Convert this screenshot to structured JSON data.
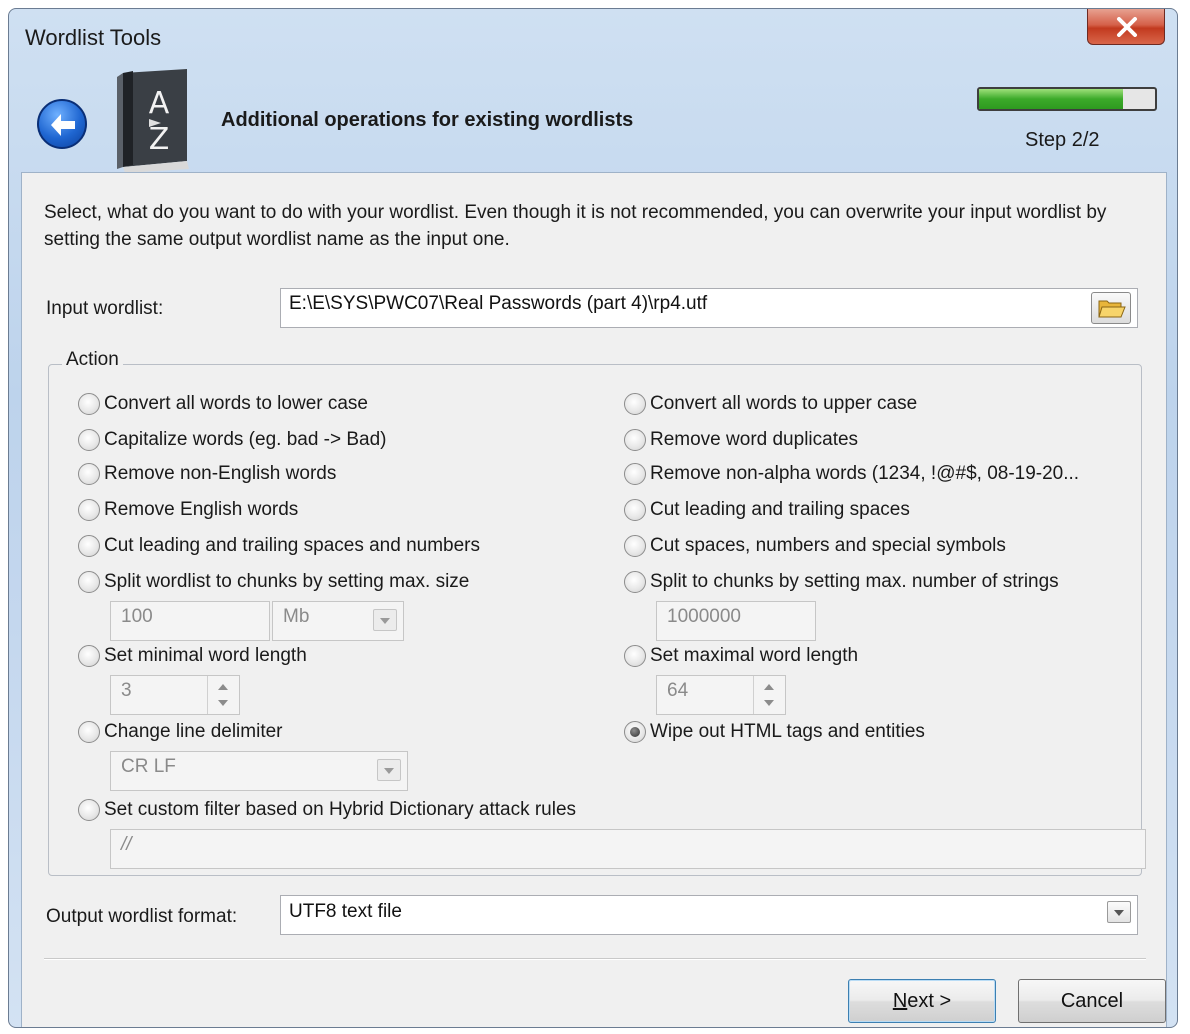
{
  "window": {
    "title": "Wordlist Tools"
  },
  "header": {
    "title": "Additional operations for existing wordlists",
    "step_label": "Step 2/2",
    "progress_fraction": 0.82,
    "progress_color": "#3caa2a"
  },
  "description": "Select, what do you want to do with your wordlist. Even though it is not recommended, you can overwrite your input wordlist by setting the same output wordlist name as the input one.",
  "input": {
    "label": "Input wordlist:",
    "value": "E:\\E\\SYS\\PWC07\\Real Passwords (part 4)\\rp4.utf"
  },
  "action": {
    "group_label": "Action",
    "left": [
      {
        "label": "Convert all words to lower case",
        "checked": false
      },
      {
        "label": "Capitalize words (eg. bad -> Bad)",
        "checked": false
      },
      {
        "label": "Remove non-English words",
        "checked": false
      },
      {
        "label": "Remove English words",
        "checked": false
      },
      {
        "label": "Cut leading and trailing spaces and numbers",
        "checked": false
      },
      {
        "label": "Split wordlist to chunks by setting max. size",
        "checked": false
      },
      {
        "label": "Set minimal word length",
        "checked": false
      },
      {
        "label": "Change line delimiter",
        "checked": false
      },
      {
        "label": "Set custom filter based on Hybrid Dictionary attack rules",
        "checked": false
      }
    ],
    "right": [
      {
        "label": "Convert all words to upper case",
        "checked": false
      },
      {
        "label": "Remove word duplicates",
        "checked": false
      },
      {
        "label": "Remove non-alpha words (1234, !@#$, 08-19-20...",
        "checked": false
      },
      {
        "label": "Cut leading and trailing spaces",
        "checked": false
      },
      {
        "label": "Cut spaces, numbers and special symbols",
        "checked": false
      },
      {
        "label": "Split to chunks by setting max. number of strings",
        "checked": false
      },
      {
        "label": "Set maximal word length",
        "checked": false
      },
      {
        "label": "Wipe out HTML tags and entities",
        "checked": true
      }
    ],
    "chunk_size_value": "100",
    "chunk_size_unit": "Mb",
    "max_strings_value": "1000000",
    "min_length_value": "3",
    "max_length_value": "64",
    "line_delimiter_value": "CR LF",
    "custom_filter_value": "//"
  },
  "output": {
    "label": "Output wordlist format:",
    "value": "UTF8 text file"
  },
  "buttons": {
    "next": "Next >",
    "cancel": "Cancel"
  }
}
